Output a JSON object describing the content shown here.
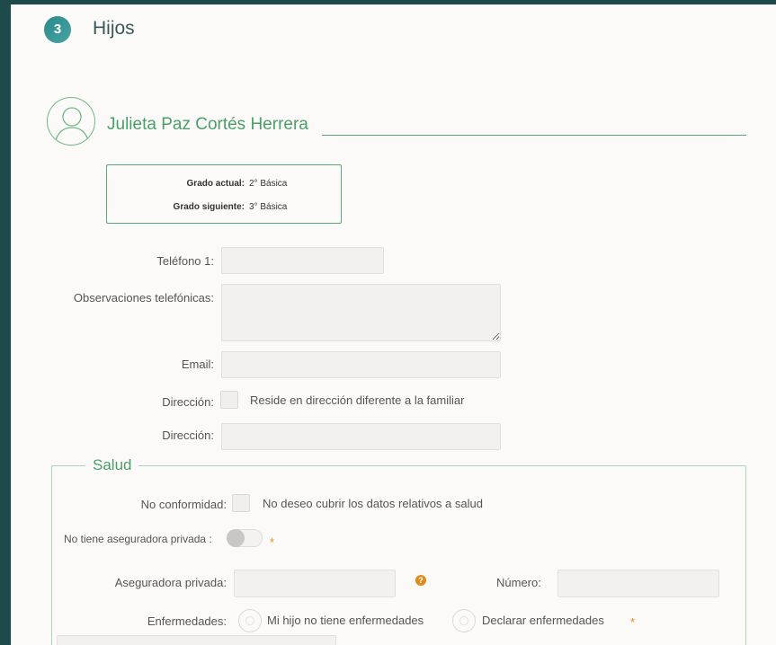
{
  "section": {
    "number": "3",
    "title": "Hijos"
  },
  "child": {
    "name": "Julieta Paz Cortés Herrera"
  },
  "grades": {
    "current_label": "Grado actual:",
    "current_value": "2° Básica",
    "next_label": "Grado siguiente:",
    "next_value": "3° Básica"
  },
  "form": {
    "phone_label": "Teléfono 1:",
    "phone_value": "",
    "phone_notes_label": "Observaciones telefónicas:",
    "phone_notes_value": "",
    "email_label": "Email:",
    "email_value": "",
    "address_check_label": "Dirección:",
    "address_check_text": "Reside en dirección diferente a la familiar",
    "address_label": "Dirección:",
    "address_value": ""
  },
  "health": {
    "legend": "Salud",
    "noconf_label": "No conformidad:",
    "noconf_text": "No deseo cubrir los datos relativos a salud",
    "no_insurer_label": "No tiene aseguradora privada :",
    "required_mark": "*",
    "insurer_label": "Aseguradora privada:",
    "help_glyph": "?",
    "number_label": "Número:",
    "diseases_label": "Enfermedades:",
    "option_none": "Mi hijo no tiene enfermedades",
    "option_declare": "Declarar enfermedades"
  },
  "colors": {
    "page_background": "#1f4a4c",
    "panel_background": "#fbfaf8",
    "accent_green": "#4a9e6a",
    "badge_teal": "#2a8a8a",
    "required_orange": "#e88a2a"
  },
  "icons": {
    "avatar": "person-silhouette-icon",
    "help": "question-circle-icon"
  }
}
